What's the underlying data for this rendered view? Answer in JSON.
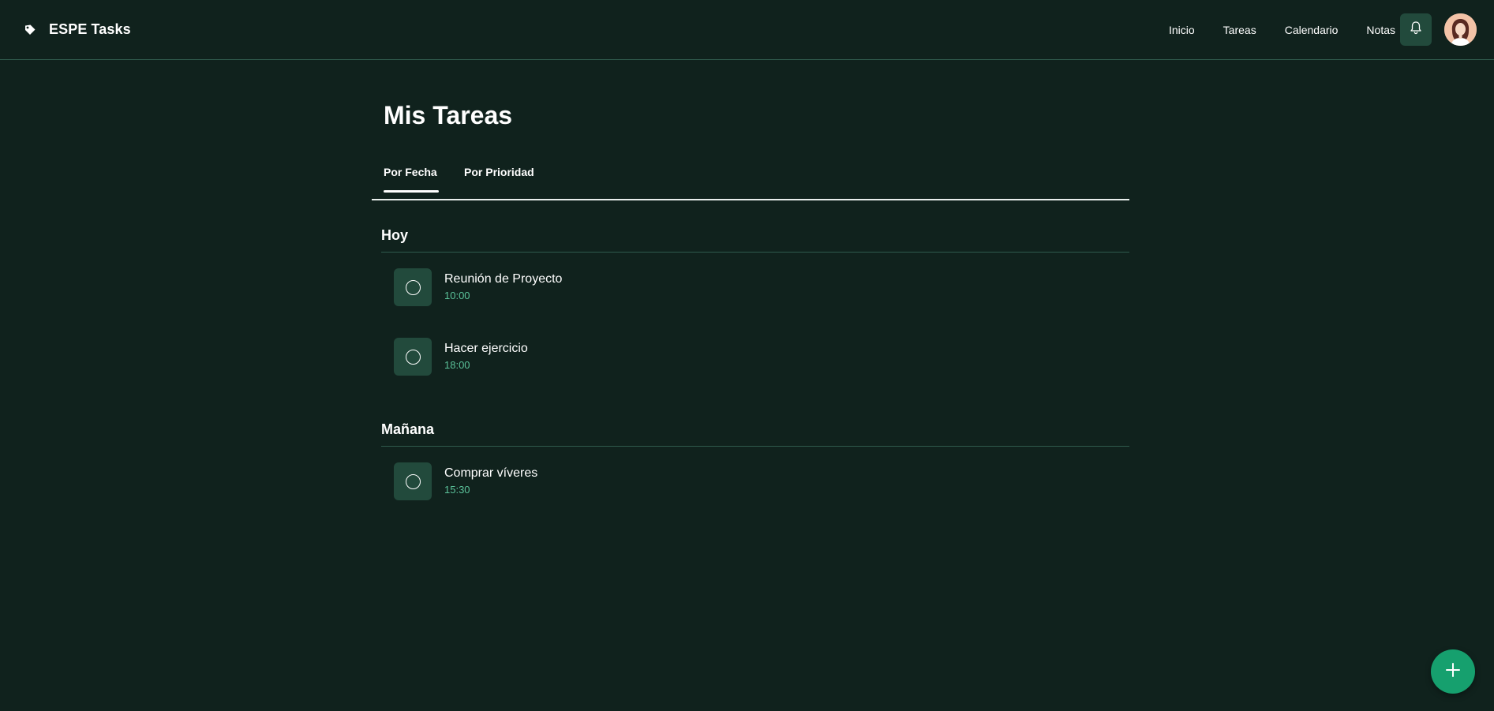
{
  "app": {
    "title": "ESPE Tasks",
    "brand_icon": "tag-icon"
  },
  "nav": {
    "items": [
      {
        "label": "Inicio"
      },
      {
        "label": "Tareas"
      },
      {
        "label": "Calendario"
      },
      {
        "label": "Notas"
      }
    ],
    "notifications_icon": "bell-icon",
    "avatar_icon": "user-avatar"
  },
  "page": {
    "title": "Mis Tareas"
  },
  "tabs": [
    {
      "label": "Por Fecha",
      "active": true
    },
    {
      "label": "Por Prioridad",
      "active": false
    }
  ],
  "sections": [
    {
      "title": "Hoy",
      "tasks": [
        {
          "title": "Reunión de Proyecto",
          "time": "10:00",
          "done": false
        },
        {
          "title": "Hacer ejercicio",
          "time": "18:00",
          "done": false
        }
      ]
    },
    {
      "title": "Mañana",
      "tasks": [
        {
          "title": "Comprar víveres",
          "time": "15:30",
          "done": false
        }
      ]
    }
  ],
  "fab": {
    "icon": "plus-icon"
  },
  "colors": {
    "background": "#10221d",
    "card": "#224a3c",
    "accent": "#16a06e",
    "time_text": "#5bc29a",
    "divider": "#2f5a4c"
  }
}
